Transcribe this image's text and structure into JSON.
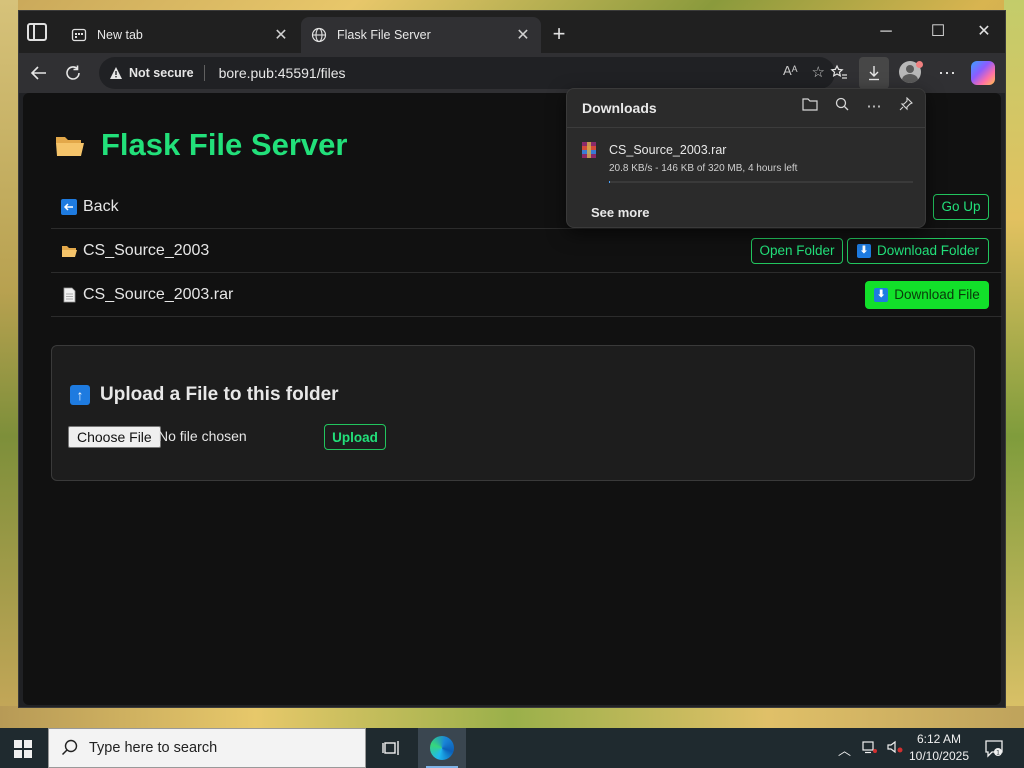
{
  "browser": {
    "tabs": [
      {
        "title": "New tab"
      },
      {
        "title": "Flask File Server"
      }
    ],
    "address": {
      "security_label": "Not secure",
      "url": "bore.pub:45591/files"
    }
  },
  "page": {
    "title": "Flask File Server",
    "rows": [
      {
        "label": "Back",
        "button": "Go Up"
      },
      {
        "label": "CS_Source_2003",
        "open_button": "Open Folder",
        "download_button": "Download Folder"
      },
      {
        "label": "CS_Source_2003.rar",
        "download_button": "Download File"
      }
    ],
    "upload": {
      "title": "Upload a File to this folder",
      "choose_button": "Choose File",
      "no_file_text": "No file chosen",
      "submit_button": "Upload"
    }
  },
  "downloads": {
    "header": "Downloads",
    "file_name": "CS_Source_2003.rar",
    "status": "20.8 KB/s - 146 KB of 320 MB, 4 hours left",
    "see_more": "See more"
  },
  "taskbar": {
    "search_placeholder": "Type here to search",
    "time": "6:12 AM",
    "date": "10/10/2025"
  },
  "colors": {
    "accent_green": "#22e07a",
    "button_green": "#12e02a",
    "info_blue": "#1e7be0"
  }
}
